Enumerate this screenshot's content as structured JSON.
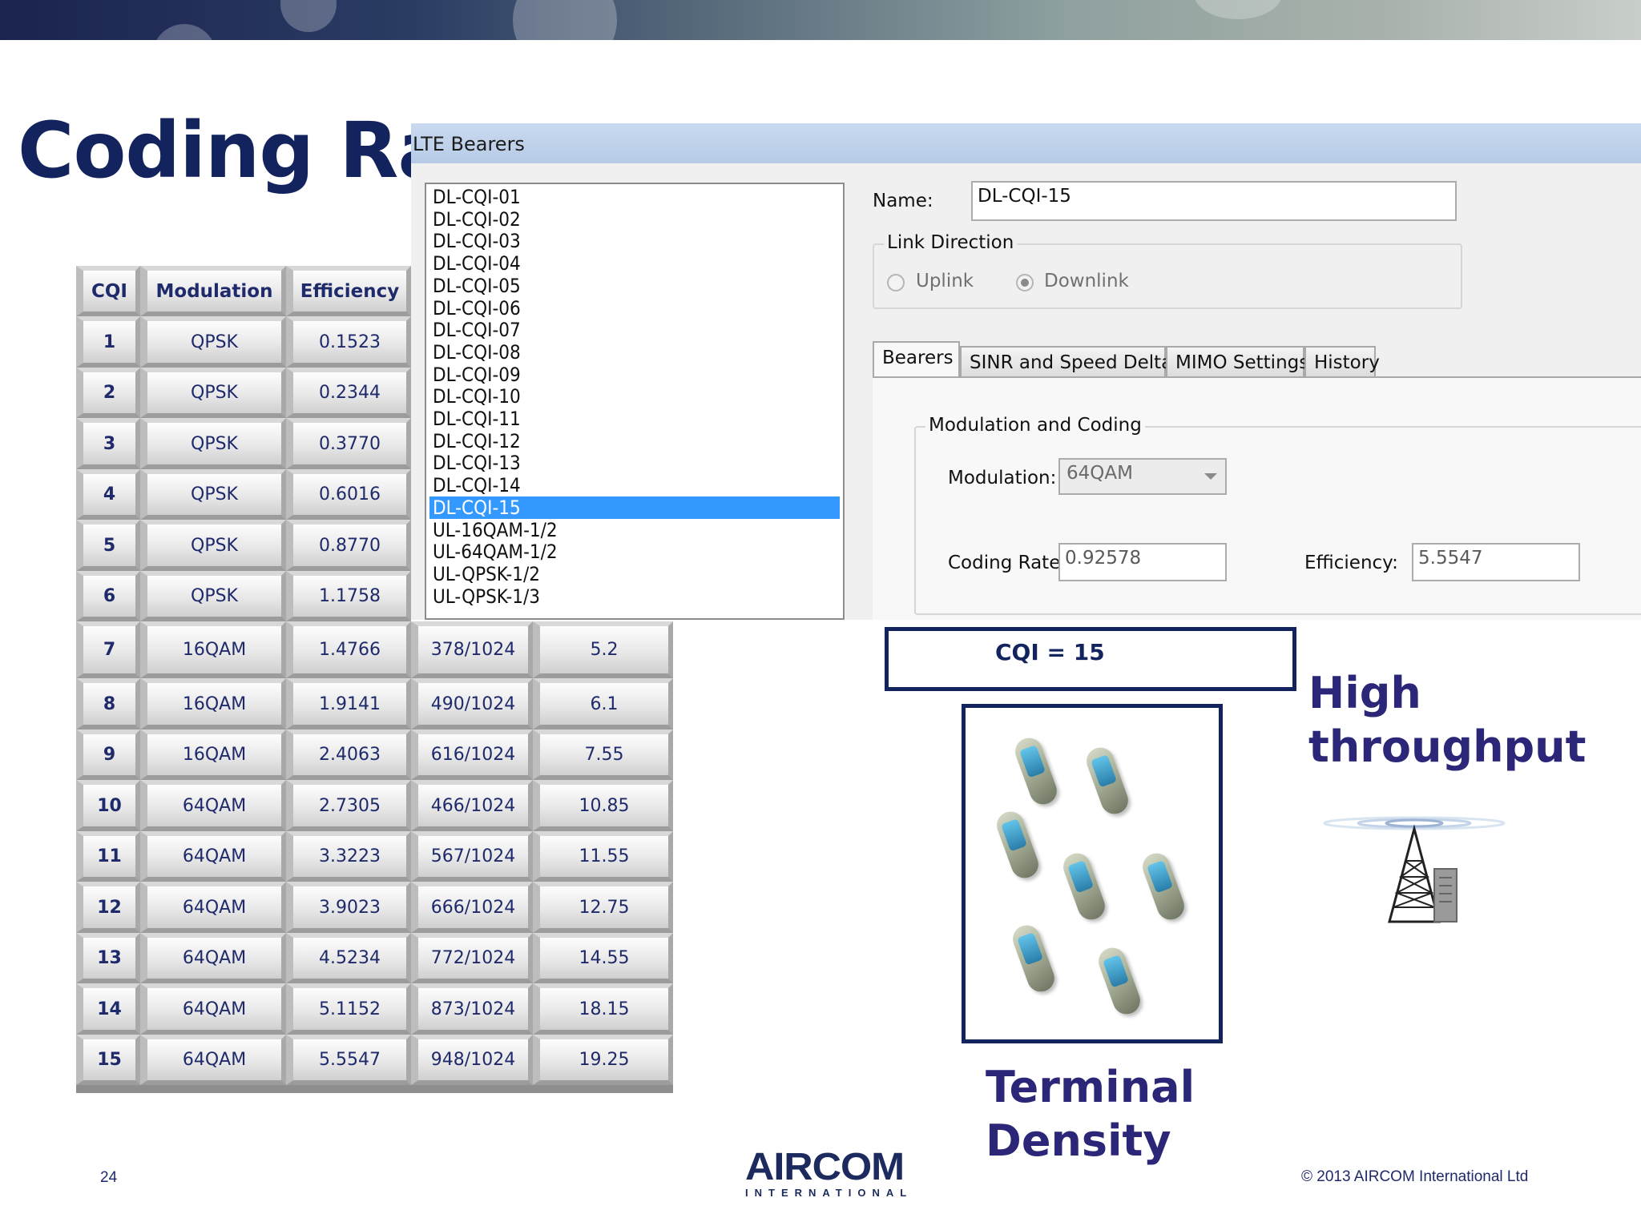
{
  "slide": {
    "title": "Coding Ra",
    "page_number": "24",
    "copyright": "© 2013 AIRCOM International Ltd",
    "logo": {
      "word": "AIRCOM",
      "sub": "INTERNATIONAL"
    },
    "brand_color": "#12235e"
  },
  "table": {
    "headers": [
      "CQI",
      "Modulation",
      "Efficiency"
    ],
    "rows": [
      [
        "1",
        "QPSK",
        "0.1523"
      ],
      [
        "2",
        "QPSK",
        "0.2344"
      ],
      [
        "3",
        "QPSK",
        "0.3770"
      ],
      [
        "4",
        "QPSK",
        "0.6016"
      ],
      [
        "5",
        "QPSK",
        "0.8770"
      ],
      [
        "6",
        "QPSK",
        "1.1758"
      ],
      [
        "7",
        "16QAM",
        "1.4766",
        "378/1024",
        "5.2"
      ],
      [
        "8",
        "16QAM",
        "1.9141",
        "490/1024",
        "6.1"
      ],
      [
        "9",
        "16QAM",
        "2.4063",
        "616/1024",
        "7.55"
      ],
      [
        "10",
        "64QAM",
        "2.7305",
        "466/1024",
        "10.85"
      ],
      [
        "11",
        "64QAM",
        "3.3223",
        "567/1024",
        "11.55"
      ],
      [
        "12",
        "64QAM",
        "3.9023",
        "666/1024",
        "12.75"
      ],
      [
        "13",
        "64QAM",
        "4.5234",
        "772/1024",
        "14.55"
      ],
      [
        "14",
        "64QAM",
        "5.1152",
        "873/1024",
        "18.15"
      ],
      [
        "15",
        "64QAM",
        "5.5547",
        "948/1024",
        "19.25"
      ]
    ]
  },
  "dialog": {
    "title": "LTE Bearers",
    "bearers": [
      "DL-CQI-01",
      "DL-CQI-02",
      "DL-CQI-03",
      "DL-CQI-04",
      "DL-CQI-05",
      "DL-CQI-06",
      "DL-CQI-07",
      "DL-CQI-08",
      "DL-CQI-09",
      "DL-CQI-10",
      "DL-CQI-11",
      "DL-CQI-12",
      "DL-CQI-13",
      "DL-CQI-14",
      "DL-CQI-15",
      "UL-16QAM-1/2",
      "UL-64QAM-1/2",
      "UL-QPSK-1/2",
      "UL-QPSK-1/3"
    ],
    "selected_bearer": "DL-CQI-15",
    "name_label": "Name:",
    "name_value": "DL-CQI-15",
    "link_direction": {
      "label": "Link Direction",
      "uplink": "Uplink",
      "downlink": "Downlink",
      "selected": "Downlink"
    },
    "tabs": [
      "Bearers",
      "SINR and Speed Delta",
      "MIMO Settings",
      "History"
    ],
    "active_tab": "Bearers",
    "modulation_coding": {
      "group_label": "Modulation and Coding",
      "modulation_label": "Modulation:",
      "modulation_value": "64QAM",
      "coding_rate_label": "Coding Rate:",
      "coding_rate_value": "0.92578",
      "efficiency_label": "Efficiency:",
      "efficiency_value": "5.5547"
    },
    "selection_color": "#3399ff"
  },
  "annotations": {
    "cqi_label": "CQI = 15",
    "throughput_line1": "High",
    "throughput_line2": "throughput",
    "density_line1": "Terminal",
    "density_line2": "Density"
  }
}
